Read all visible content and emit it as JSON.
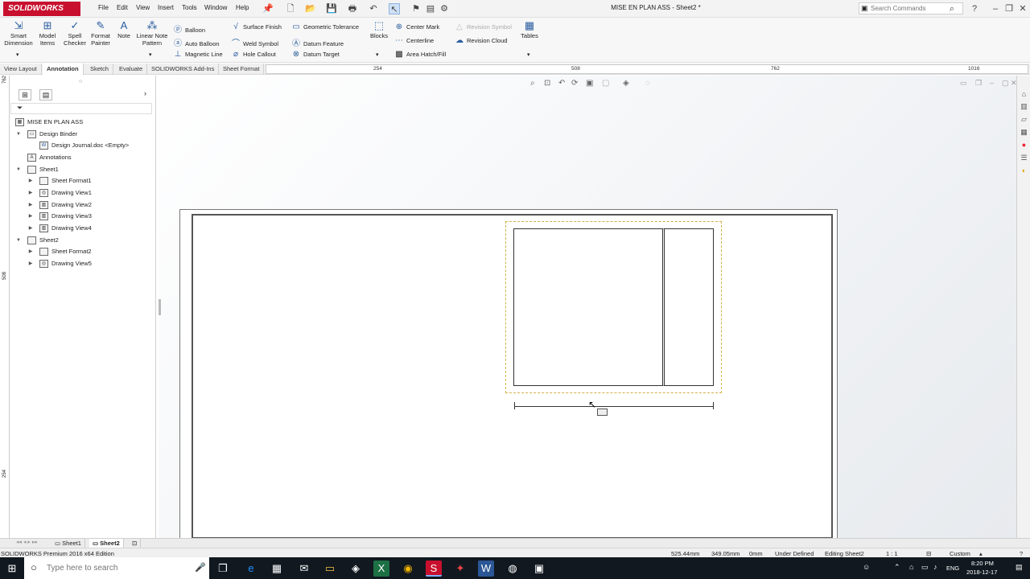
{
  "app": {
    "logo_text": "SOLIDWORKS",
    "document_title": "MISE EN PLAN ASS - Sheet2 *"
  },
  "menu": [
    "File",
    "Edit",
    "View",
    "Insert",
    "Tools",
    "Window",
    "Help"
  ],
  "search": {
    "placeholder": "Search Commands"
  },
  "ribbon": {
    "smart_dimension": "Smart Dimension",
    "model_items": "Model Items",
    "spell_checker": "Spell Checker",
    "format_painter": "Format Painter",
    "note": "Note",
    "linear_note_pattern": "Linear Note Pattern",
    "balloon": "Balloon",
    "auto_balloon": "Auto Balloon",
    "magnetic_line": "Magnetic Line",
    "surface_finish": "Surface Finish",
    "weld_symbol": "Weld Symbol",
    "hole_callout": "Hole Callout",
    "geometric_tolerance": "Geometric Tolerance",
    "datum_feature": "Datum Feature",
    "datum_target": "Datum Target",
    "blocks": "Blocks",
    "center_mark": "Center Mark",
    "centerline": "Centerline",
    "area_hatch_fill": "Area Hatch/Fill",
    "revision_symbol": "Revision Symbol",
    "revision_cloud": "Revision Cloud",
    "tables": "Tables"
  },
  "tabs": [
    "View Layout",
    "Annotation",
    "Sketch",
    "Evaluate",
    "SOLIDWORKS Add-Ins",
    "Sheet Format"
  ],
  "ruler_h": [
    "254",
    "508",
    "762",
    "1016"
  ],
  "ruler_v": [
    "762",
    "508",
    "254"
  ],
  "tree": {
    "root": "MISE EN PLAN ASS",
    "design_binder": "Design Binder",
    "design_journal": "Design Journal.doc <Empty>",
    "annotations": "Annotations",
    "sheet1": "Sheet1",
    "sheet_format1": "Sheet Format1",
    "drawing_view1": "Drawing View1",
    "drawing_view2": "Drawing View2",
    "drawing_view3": "Drawing View3",
    "drawing_view4": "Drawing View4",
    "sheet2": "Sheet2",
    "sheet_format2": "Sheet Format2",
    "drawing_view5": "Drawing View5"
  },
  "sheet_tabs": [
    "Sheet1",
    "Sheet2"
  ],
  "status": {
    "edition": "SOLIDWORKS Premium 2016 x64 Edition",
    "x": "525.44mm",
    "y": "349.05mm",
    "z": "0mm",
    "state": "Under Defined",
    "editing": "Editing Sheet2",
    "scale": "1 : 1",
    "units": "Custom"
  },
  "taskbar": {
    "search_placeholder": "Type here to search",
    "lang": "ENG",
    "time": "8:20 PM",
    "date": "2018-12-17"
  },
  "colors": {
    "brand": "#c8102e",
    "view_border": "#d4b24a",
    "accent": "#2a5d9f"
  }
}
